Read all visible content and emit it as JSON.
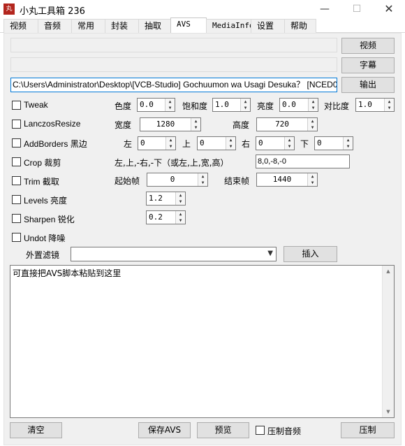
{
  "window": {
    "title": "小丸工具箱 236",
    "icon_text": "丸",
    "minimize": "—",
    "maximize": "☐",
    "close": "✕"
  },
  "tabs": [
    {
      "label": "视频"
    },
    {
      "label": "音频"
    },
    {
      "label": "常用"
    },
    {
      "label": "封装"
    },
    {
      "label": "抽取"
    },
    {
      "label": "AVS",
      "active": true
    },
    {
      "label": "MediaInfo"
    },
    {
      "label": "设置"
    },
    {
      "label": "帮助"
    }
  ],
  "io": {
    "video_button": "视频",
    "subtitle_button": "字幕",
    "output_button": "输出",
    "output_path": "C:\\Users\\Administrator\\Desktop\\[VCB-Studio] Gochuumon wa Usagi Desuka？ [NCED0"
  },
  "tweak": {
    "label": "Tweak",
    "hue_label": "色度",
    "hue": "0.0",
    "saturation_label": "饱和度",
    "saturation": "1.0",
    "brightness_label": "亮度",
    "brightness": "0.0",
    "contrast_label": "对比度",
    "contrast": "1.0"
  },
  "resize": {
    "label": "LanczosResize",
    "width_label": "宽度",
    "width": "1280",
    "height_label": "高度",
    "height": "720"
  },
  "addborders": {
    "label": "AddBorders 黑边",
    "left_label": "左",
    "left": "0",
    "top_label": "上",
    "top": "0",
    "right_label": "右",
    "right": "0",
    "bottom_label": "下",
    "bottom": "0"
  },
  "crop": {
    "label": "Crop 裁剪",
    "hint": "左,上,-右,-下（或左,上,宽,高）",
    "value": "8,0,-8,-0"
  },
  "trim": {
    "label": "Trim 截取",
    "start_label": "起始帧",
    "start": "0",
    "end_label": "结束帧",
    "end": "1440"
  },
  "levels": {
    "label": "Levels 亮度",
    "value": "1.2"
  },
  "sharpen": {
    "label": "Sharpen 锐化",
    "value": "0.2"
  },
  "undot": {
    "label": "Undot 降噪"
  },
  "filter": {
    "label": "外置滤镜",
    "value": "",
    "insert_button": "插入"
  },
  "script": {
    "placeholder": "可直接把AVS脚本粘贴到这里"
  },
  "actions": {
    "clear_button": "清空",
    "save_avs_button": "保存AVS",
    "preview_button": "预览",
    "audio_checkbox": "压制音频",
    "encode_button": "压制"
  }
}
